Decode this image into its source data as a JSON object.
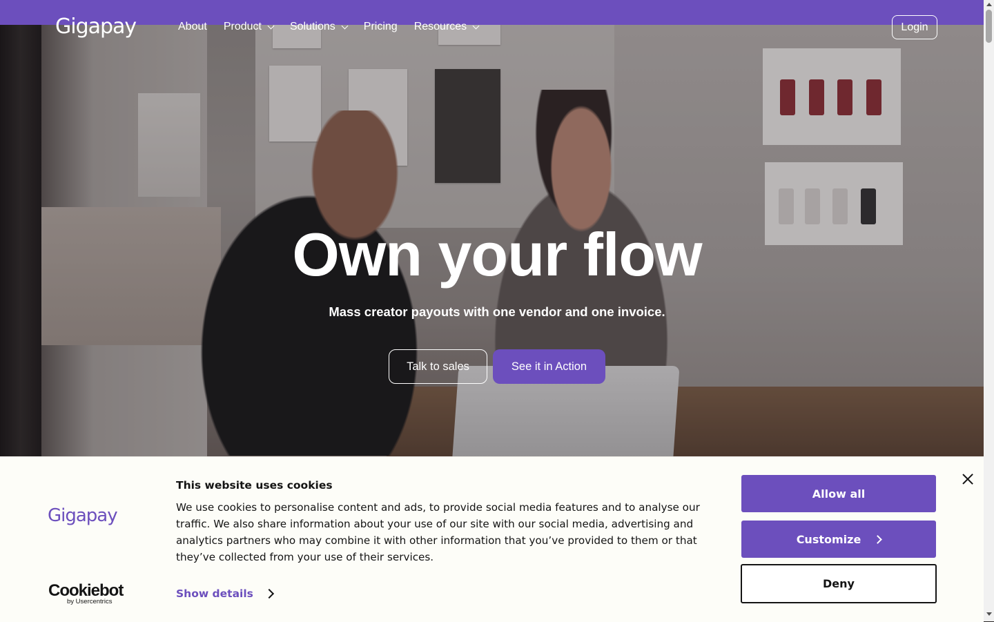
{
  "brand": {
    "name": "Gigapay",
    "accent": "#6c4fbd"
  },
  "nav": {
    "links": [
      {
        "label": "About",
        "has_dropdown": false
      },
      {
        "label": "Product",
        "has_dropdown": true
      },
      {
        "label": "Solutions",
        "has_dropdown": true
      },
      {
        "label": "Pricing",
        "has_dropdown": false
      },
      {
        "label": "Resources",
        "has_dropdown": true
      }
    ],
    "login_label": "Login"
  },
  "hero": {
    "headline": "Own your flow",
    "subheadline": "Mass creator payouts with one vendor and one invoice.",
    "cta_secondary": "Talk to sales",
    "cta_primary": "See it in Action"
  },
  "cookie_banner": {
    "logo_text": "Gigapay",
    "title": "This website uses cookies",
    "body": "We use cookies to personalise content and ads, to provide social media features and to analyse our traffic. We also share information about your use of our site with our social media, advertising and analytics partners who may combine it with other information that you’ve provided to them or that they’ve collected from your use of their services.",
    "show_details_label": "Show details",
    "allow_all_label": "Allow all",
    "customize_label": "Customize",
    "deny_label": "Deny",
    "provider_brand": "Cookiebot",
    "provider_sub": "by Usercentrics"
  }
}
